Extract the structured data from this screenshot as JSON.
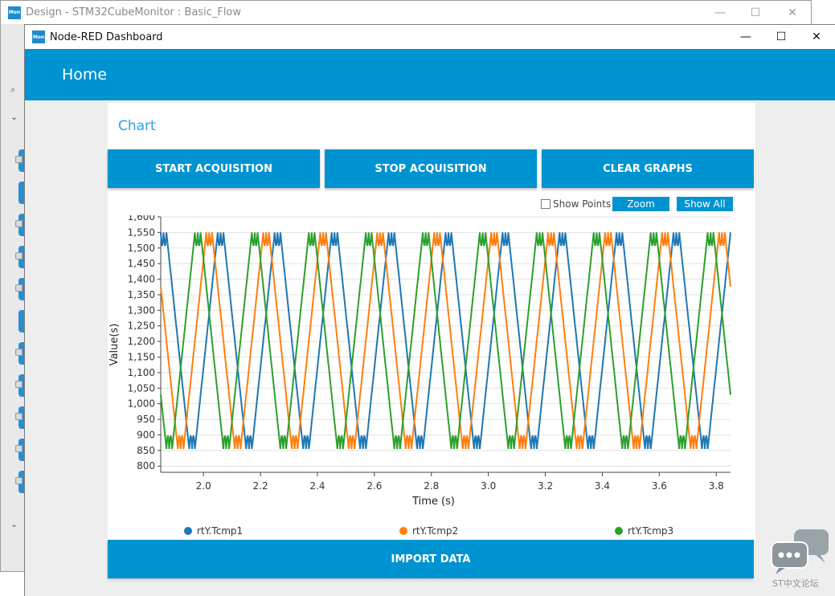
{
  "background_window": {
    "title": "Design - STM32CubeMonitor : Basic_Flow",
    "icon": "Mon"
  },
  "window": {
    "title": "Node-RED Dashboard",
    "icon": "Mon",
    "controls": {
      "minimize": "—",
      "maximize": "☐",
      "close": "✕"
    }
  },
  "header": {
    "title": "Home",
    "color": "#0093d1"
  },
  "card": {
    "title": "Chart",
    "buttons": {
      "start": "START ACQUISITION",
      "stop": "STOP ACQUISITION",
      "clear": "CLEAR GRAPHS",
      "import": "IMPORT DATA"
    },
    "options": {
      "show_points": "Show Points",
      "zoom": "Zoom",
      "show_all": "Show All"
    }
  },
  "chart_data": {
    "type": "line",
    "title": "",
    "xlabel": "Time (s)",
    "ylabel": "Value(s)",
    "xlim": [
      1.85,
      3.85
    ],
    "ylim": [
      780,
      1600
    ],
    "x_ticks": [
      "2.0",
      "2.2",
      "2.4",
      "2.6",
      "2.8",
      "3.0",
      "3.2",
      "3.4",
      "3.6",
      "3.8"
    ],
    "y_ticks": [
      "800",
      "850",
      "900",
      "950",
      "1,000",
      "1,050",
      "1,100",
      "1,150",
      "1,200",
      "1,250",
      "1,300",
      "1,350",
      "1,400",
      "1,450",
      "1,500",
      "1,550",
      "1,600"
    ],
    "grid": true,
    "series": [
      {
        "name": "rtY.Tcmp1",
        "color": "#1f77b4",
        "period": 0.2,
        "phase": 0.0,
        "min": 855,
        "max": 1550
      },
      {
        "name": "rtY.Tcmp2",
        "color": "#ff7f0e",
        "period": 0.2,
        "phase": 0.2,
        "min": 855,
        "max": 1550
      },
      {
        "name": "rtY.Tcmp3",
        "color": "#2ca02c",
        "period": 0.2,
        "phase": 0.4,
        "min": 855,
        "max": 1550
      }
    ],
    "legend_position": "bottom"
  },
  "watermark": {
    "text": "ST中文论坛",
    "icon": "chat-bubble-icon"
  }
}
